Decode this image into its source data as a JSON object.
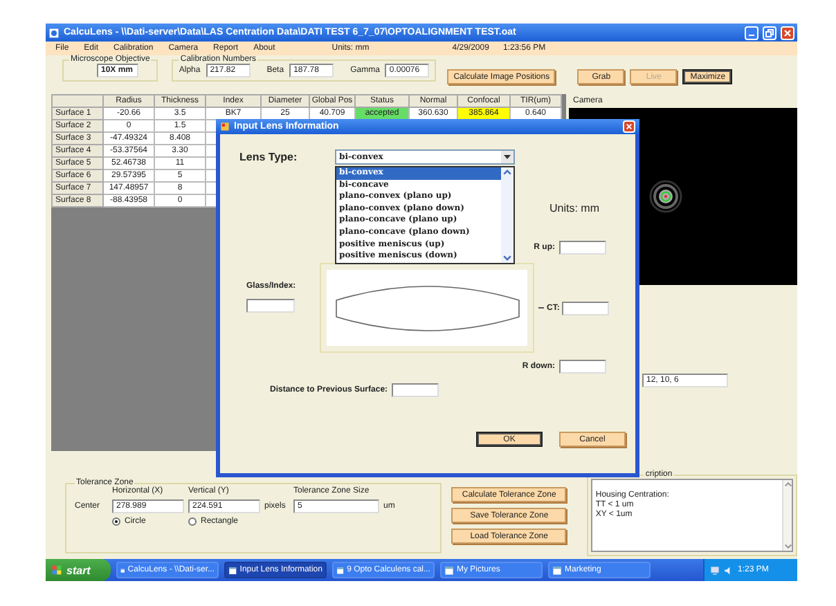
{
  "window": {
    "title": "CalcuLens - \\\\Dati-server\\Data\\LAS Centration Data\\DATI TEST 6_7_07\\OPTOALIGNMENT TEST.oat"
  },
  "menu": [
    "File",
    "Edit",
    "Calibration",
    "Camera",
    "Report",
    "About"
  ],
  "status": {
    "units": "Units: mm",
    "date": "4/29/2009",
    "time": "1:23:56 PM"
  },
  "objective": {
    "label": "Microscope Objective",
    "value": "10X mm"
  },
  "calibration": {
    "label": "Calibration Numbers",
    "fields": [
      {
        "label": "Alpha",
        "value": "217.82"
      },
      {
        "label": "Beta",
        "value": "187.78"
      },
      {
        "label": "Gamma",
        "value": "0.00076"
      }
    ]
  },
  "toolbar_buttons": [
    {
      "label": "Calculate Image Positions",
      "disabled": false,
      "focused": false
    },
    {
      "label": "Grab",
      "disabled": false,
      "focused": false
    },
    {
      "label": "Live",
      "disabled": true,
      "focused": false
    },
    {
      "label": "Maximize",
      "disabled": false,
      "focused": true
    }
  ],
  "table": {
    "columns": [
      "Radius",
      "Thickness",
      "Index",
      "Diameter",
      "Global Pos",
      "Status",
      "Normal",
      "Confocal",
      "TIR(um)"
    ],
    "rows": [
      {
        "label": "Surface 1",
        "cells": [
          {
            "text": "-20.66"
          },
          {
            "text": "3.5"
          },
          {
            "text": "BK7"
          },
          {
            "text": "25"
          },
          {
            "text": "40.709"
          },
          {
            "text": "accepted",
            "color": "#66dd66"
          },
          {
            "text": "360.630"
          },
          {
            "text": "385.864",
            "color": "#ffff00"
          },
          {
            "text": "0.640"
          }
        ]
      },
      {
        "label": "Surface 2",
        "cells": [
          {
            "text": "0"
          },
          {
            "text": "1.5"
          }
        ]
      },
      {
        "label": "Surface 3",
        "cells": [
          {
            "text": "-47.49324"
          },
          {
            "text": "8.408"
          }
        ]
      },
      {
        "label": "Surface 4",
        "cells": [
          {
            "text": "-53.37564"
          },
          {
            "text": "3.30"
          }
        ]
      },
      {
        "label": "Surface 5",
        "cells": [
          {
            "text": "52.46738"
          },
          {
            "text": "11"
          }
        ]
      },
      {
        "label": "Surface 6",
        "cells": [
          {
            "text": "29.57395"
          },
          {
            "text": "5"
          }
        ]
      },
      {
        "label": "Surface 7",
        "cells": [
          {
            "text": "147.48957"
          },
          {
            "text": "8"
          }
        ]
      },
      {
        "label": "Surface 8",
        "cells": [
          {
            "text": "-88.43958"
          },
          {
            "text": "0"
          }
        ]
      }
    ]
  },
  "camera": {
    "label": "Camera",
    "readout": "12, 10, 6"
  },
  "tolerance": {
    "label": "Tolerance Zone",
    "center_label": "Center",
    "horizontal": {
      "label": "Horizontal (X)",
      "value": "278.989"
    },
    "vertical": {
      "label": "Vertical (Y)",
      "value": "224.591"
    },
    "pixels_label": "pixels",
    "size": {
      "label": "Tolerance Zone Size",
      "value": "5"
    },
    "unit": "um",
    "shapes": [
      {
        "label": "Circle",
        "selected": true
      },
      {
        "label": "Rectangle",
        "selected": false
      }
    ]
  },
  "tolerance_buttons": [
    "Calculate Tolerance Zone",
    "Save Tolerance Zone",
    "Load Tolerance Zone"
  ],
  "description": {
    "label": "cription",
    "lines": [
      "Housing Centration:",
      "TT < 1 um",
      "XY < 1um"
    ]
  },
  "dialog": {
    "title": "Input Lens Information",
    "lens_type_label": "Lens Type:",
    "lens_type": "bi-convex",
    "options": [
      {
        "label": "bi-convex",
        "selected": true
      },
      {
        "label": "bi-concave",
        "selected": false
      },
      {
        "label": "plano-convex (plano up)",
        "selected": false
      },
      {
        "label": "plano-convex (plano down)",
        "selected": false
      },
      {
        "label": "plano-concave (plano up)",
        "selected": false
      },
      {
        "label": "plano-concave (plano down)",
        "selected": false
      },
      {
        "label": "positive meniscus (up)",
        "selected": false
      },
      {
        "label": "positive meniscus (down)",
        "selected": false
      }
    ],
    "units": "Units: mm",
    "r_up": "R up:",
    "glass_index": "Glass/Index:",
    "ct": "CT:",
    "r_down": "R down:",
    "distance": "Distance to Previous Surface:",
    "buttons": [
      {
        "label": "OK",
        "focused": true
      },
      {
        "label": "Cancel",
        "focused": false
      }
    ]
  },
  "taskbar": {
    "start": "start",
    "items": [
      {
        "label": "CalcuLens - \\\\Dati-ser...",
        "selected": false
      },
      {
        "label": "Input Lens Information",
        "selected": true
      },
      {
        "label": "9 Opto Calculens cal...",
        "selected": false
      },
      {
        "label": "My Pictures",
        "selected": false
      },
      {
        "label": "Marketing",
        "selected": false
      }
    ],
    "time": "1:23 PM"
  }
}
